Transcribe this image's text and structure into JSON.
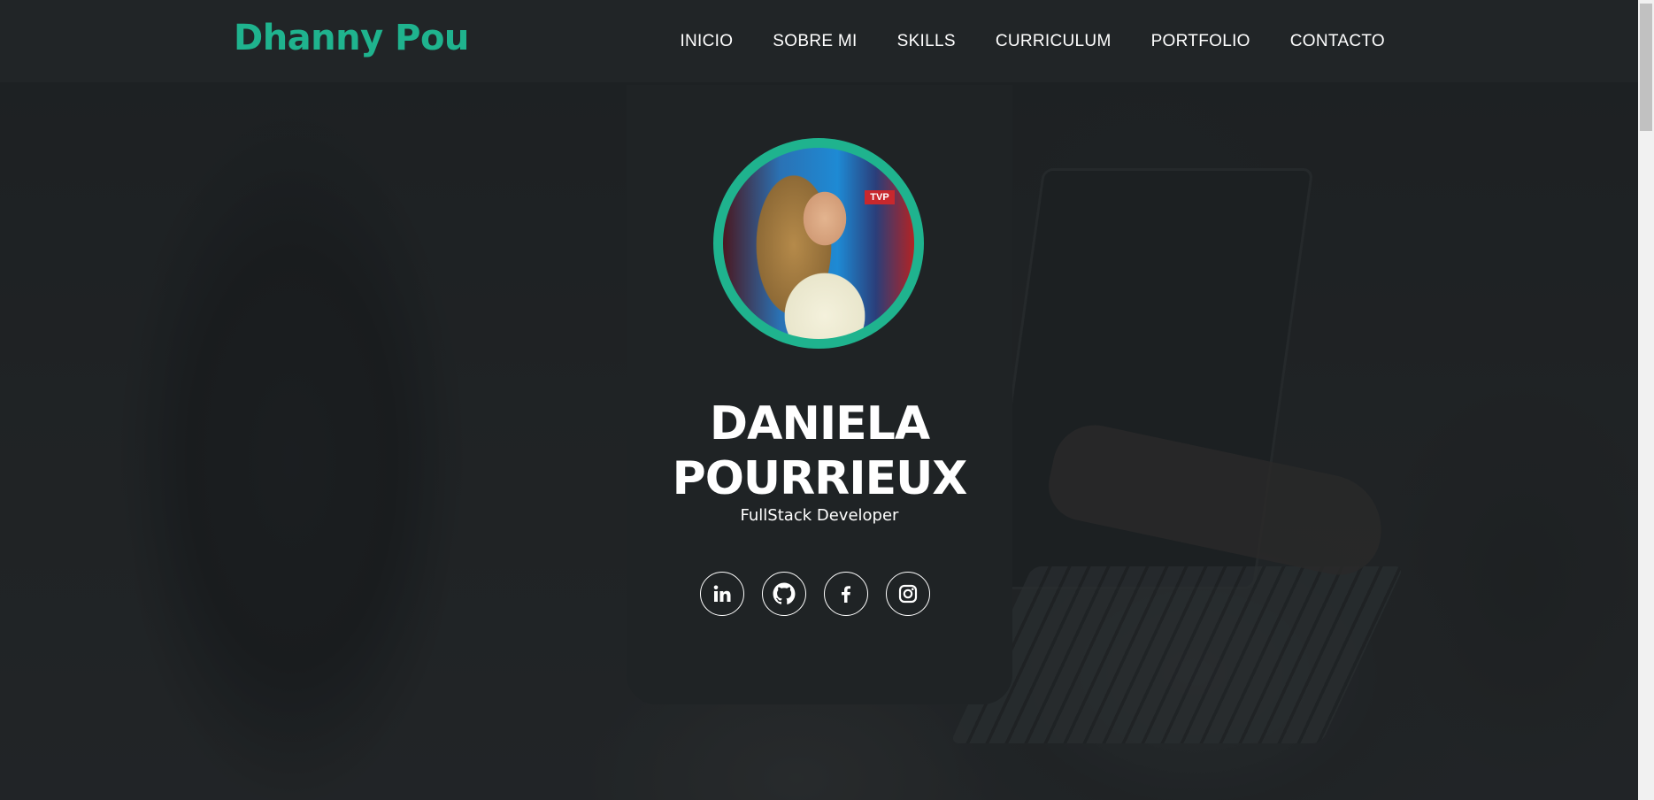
{
  "header": {
    "logo": "Dhanny Pou",
    "nav": [
      "INICIO",
      "SOBRE MI",
      "SKILLS",
      "CURRICULUM",
      "PORTFOLIO",
      "CONTACTO"
    ]
  },
  "profile": {
    "name_line1": "DANIELA",
    "name_line2": "POURRIEUX",
    "role": "FullStack Developer",
    "photo_badge": "TVP",
    "socials": [
      {
        "icon": "linkedin-icon"
      },
      {
        "icon": "github-icon"
      },
      {
        "icon": "facebook-icon"
      },
      {
        "icon": "instagram-icon"
      }
    ]
  },
  "colors": {
    "accent": "#1fb38e",
    "header_bg": "#212527",
    "card_bg": "#1f2325",
    "text": "#ffffff"
  }
}
